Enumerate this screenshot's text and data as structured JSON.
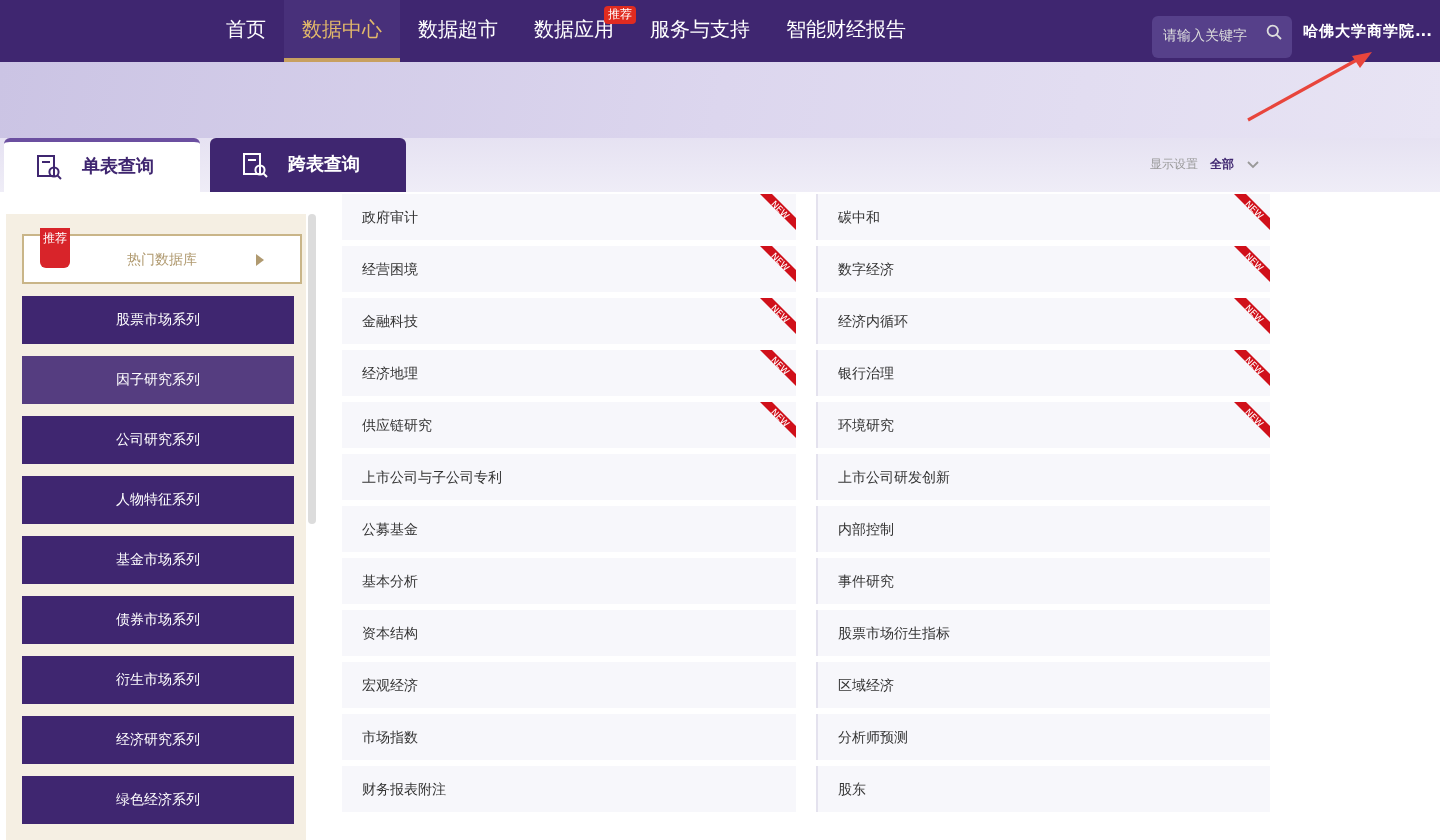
{
  "nav": {
    "items": [
      {
        "label": "首页",
        "selected": false
      },
      {
        "label": "数据中心",
        "selected": true
      },
      {
        "label": "数据超市",
        "selected": false
      },
      {
        "label": "数据应用",
        "selected": false,
        "badge": "推荐"
      },
      {
        "label": "服务与支持",
        "selected": false
      },
      {
        "label": "智能财经报告",
        "selected": false
      }
    ],
    "search": {
      "placeholder": "请输入关键字"
    },
    "user": "哈佛大学商学院..."
  },
  "tabs": [
    {
      "label": "单表查询",
      "selected": true
    },
    {
      "label": "跨表查询",
      "selected": false
    }
  ],
  "display_settings": {
    "label": "显示设置",
    "value": "全部"
  },
  "sidebar": {
    "featured": {
      "badge": "推荐",
      "label": "热门数据库"
    },
    "items": [
      {
        "label": "股票市场系列",
        "selected": false
      },
      {
        "label": "因子研究系列",
        "selected": true
      },
      {
        "label": "公司研究系列",
        "selected": false
      },
      {
        "label": "人物特征系列",
        "selected": false
      },
      {
        "label": "基金市场系列",
        "selected": false
      },
      {
        "label": "债券市场系列",
        "selected": false
      },
      {
        "label": "衍生市场系列",
        "selected": false
      },
      {
        "label": "经济研究系列",
        "selected": false
      },
      {
        "label": "绿色经济系列",
        "selected": false
      }
    ]
  },
  "databases": [
    {
      "label": "政府审计",
      "badge": "NEW"
    },
    {
      "label": "碳中和",
      "badge": "NEW"
    },
    {
      "label": "经营困境",
      "badge": "NEW"
    },
    {
      "label": "数字经济",
      "badge": "NEW"
    },
    {
      "label": "金融科技",
      "badge": "NEW"
    },
    {
      "label": "经济内循环",
      "badge": "NEW"
    },
    {
      "label": "经济地理",
      "badge": "NEW"
    },
    {
      "label": "银行治理",
      "badge": "NEW"
    },
    {
      "label": "供应链研究",
      "badge": "NEW"
    },
    {
      "label": "环境研究",
      "badge": "NEW"
    },
    {
      "label": "上市公司与子公司专利"
    },
    {
      "label": "上市公司研发创新"
    },
    {
      "label": "公募基金"
    },
    {
      "label": "内部控制"
    },
    {
      "label": "基本分析"
    },
    {
      "label": "事件研究"
    },
    {
      "label": "资本结构"
    },
    {
      "label": "股票市场衍生指标"
    },
    {
      "label": "宏观经济"
    },
    {
      "label": "区域经济"
    },
    {
      "label": "市场指数"
    },
    {
      "label": "分析师预测"
    },
    {
      "label": "财务报表附注"
    },
    {
      "label": "股东"
    }
  ]
}
